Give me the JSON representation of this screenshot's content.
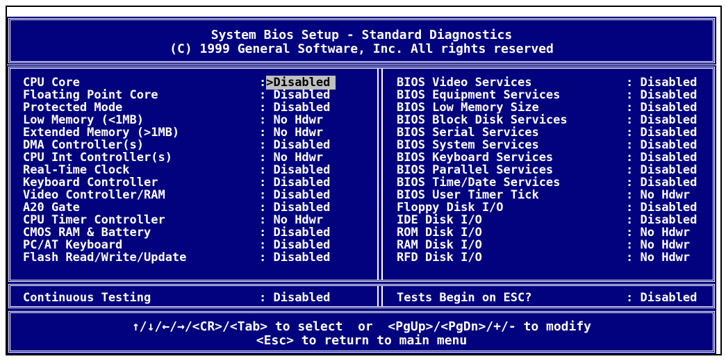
{
  "header": {
    "title": "System Bios Setup - Standard Diagnostics",
    "copyright": "(C) 1999 General Software, Inc. All rights reserved"
  },
  "left_items": [
    {
      "label": "CPU Core",
      "value": ">Disabled",
      "selected": true
    },
    {
      "label": "Floating Point Core",
      "value": "Disabled"
    },
    {
      "label": "Protected Mode",
      "value": "Disabled"
    },
    {
      "label": "Low Memory (<1MB)",
      "value": "No Hdwr"
    },
    {
      "label": "Extended Memory (>1MB)",
      "value": "No Hdwr"
    },
    {
      "label": "DMA Controller(s)",
      "value": "Disabled"
    },
    {
      "label": "CPU Int Controller(s)",
      "value": "No Hdwr"
    },
    {
      "label": "Real-Time Clock",
      "value": "Disabled"
    },
    {
      "label": "Keyboard Controller",
      "value": "Disabled"
    },
    {
      "label": "Video Controller/RAM",
      "value": "Disabled"
    },
    {
      "label": "A20 Gate",
      "value": "Disabled"
    },
    {
      "label": "CPU Timer Controller",
      "value": "No Hdwr"
    },
    {
      "label": "CMOS RAM & Battery",
      "value": "Disabled"
    },
    {
      "label": "PC/AT Keyboard",
      "value": "Disabled"
    },
    {
      "label": "Flash Read/Write/Update",
      "value": "Disabled"
    }
  ],
  "right_items": [
    {
      "label": "BIOS Video Services",
      "value": "Disabled"
    },
    {
      "label": "BIOS Equipment Services",
      "value": "Disabled"
    },
    {
      "label": "BIOS Low Memory Size",
      "value": "Disabled"
    },
    {
      "label": "BIOS Block Disk Services",
      "value": "Disabled"
    },
    {
      "label": "BIOS Serial Services",
      "value": "Disabled"
    },
    {
      "label": "BIOS System Services",
      "value": "Disabled"
    },
    {
      "label": "BIOS Keyboard Services",
      "value": "Disabled"
    },
    {
      "label": "BIOS Parallel Services",
      "value": "Disabled"
    },
    {
      "label": "BIOS Time/Date Services",
      "value": "Disabled"
    },
    {
      "label": "BIOS User Timer Tick",
      "value": "No Hdwr"
    },
    {
      "label": "Floppy Disk I/O",
      "value": "Disabled"
    },
    {
      "label": "IDE Disk I/O",
      "value": "Disabled"
    },
    {
      "label": "ROM Disk I/O",
      "value": "No Hdwr"
    },
    {
      "label": "RAM Disk I/O",
      "value": "No Hdwr"
    },
    {
      "label": "RFD Disk I/O",
      "value": "No Hdwr"
    }
  ],
  "continuous": {
    "label": "Continuous Testing",
    "value": "Disabled"
  },
  "esc_tests": {
    "label": "Tests Begin on ESC?",
    "value": "Disabled"
  },
  "footer": {
    "line1": "↑/↓/←/→/<CR>/<Tab> to select  or  <PgUp>/<PgDn>/+/- to modify",
    "line2": "<Esc> to return to main menu"
  },
  "colors": {
    "panel_bg": "#02027e",
    "text": "#ffffff",
    "selection_bg": "#c0c0c0"
  }
}
